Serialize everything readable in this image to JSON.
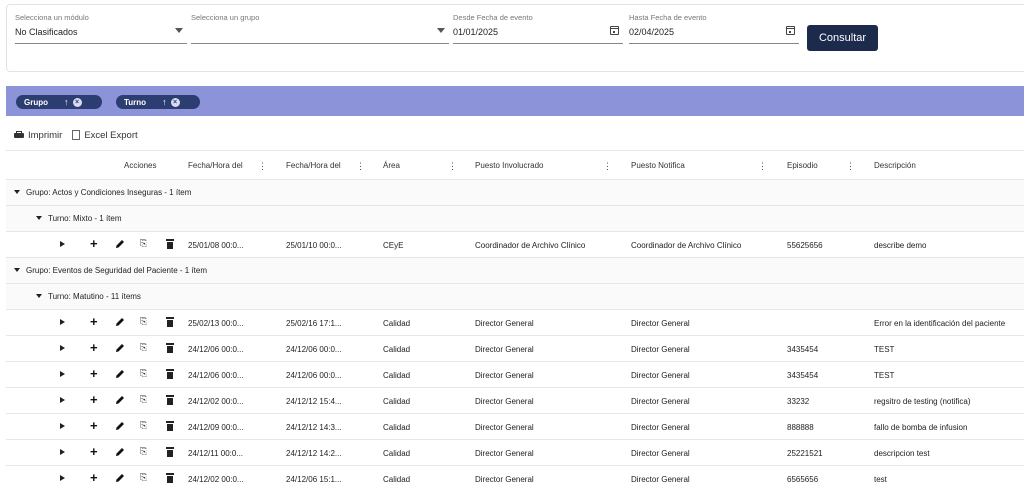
{
  "filters": {
    "modulo": {
      "label": "Selecciona un módulo",
      "value": "No Clasificados"
    },
    "grupo": {
      "label": "Selecciona un grupo",
      "value": ""
    },
    "desde": {
      "label": "Desde Fecha de evento",
      "value": "01/01/2025"
    },
    "hasta": {
      "label": "Hasta Fecha de evento",
      "value": "02/04/2025"
    },
    "consultar_label": "Consultar"
  },
  "group_chips": [
    {
      "label": "Grupo",
      "arrow": "↑",
      "remove": "×"
    },
    {
      "label": "Turno",
      "arrow": "↑",
      "remove": "×"
    }
  ],
  "toolbar": {
    "print_label": "Imprimir",
    "excel_label": "Excel Export"
  },
  "columns": {
    "acciones": "Acciones",
    "fecha_hora_1": "Fecha/Hora del",
    "fecha_hora_2": "Fecha/Hora del",
    "area": "Área",
    "puesto_involucrado": "Puesto Involucrado",
    "puesto_notifica": "Puesto Notifica",
    "episodio": "Episodio",
    "descripcion": "Descripción",
    "menu_glyph": "⋮"
  },
  "groups": [
    {
      "label": "Grupo: Actos y Condiciones Inseguras - 1 ítem"
    },
    {
      "label": "Grupo: Eventos de Seguridad del Paciente - 1 ítem"
    }
  ],
  "subgroups": [
    {
      "label": "Turno: Mixto - 1 ítem"
    },
    {
      "label": "Turno: Matutino - 11 ítems"
    }
  ],
  "icons": {
    "plus": "+",
    "clip": "⎘"
  },
  "rows": [
    {
      "fecha1": "25/01/08 00:0...",
      "fecha2": "25/01/10 00:0...",
      "area": "CEyE",
      "puesto_involucrado": "Coordinador de Archivo Clínico",
      "puesto_notifica": "Coordinador de Archivo Clínico",
      "episodio": "55625656",
      "descripcion": "describe demo"
    },
    {
      "fecha1": "25/02/13 00:0...",
      "fecha2": "25/02/16 17:1...",
      "area": "Calidad",
      "puesto_involucrado": "Director General",
      "puesto_notifica": "Director General",
      "episodio": "",
      "descripcion": "Error en la identificación del paciente"
    },
    {
      "fecha1": "24/12/06 00:0...",
      "fecha2": "24/12/06 00:0...",
      "area": "Calidad",
      "puesto_involucrado": "Director General",
      "puesto_notifica": "Director General",
      "episodio": "3435454",
      "descripcion": "TEST"
    },
    {
      "fecha1": "24/12/06 00:0...",
      "fecha2": "24/12/06 00:0...",
      "area": "Calidad",
      "puesto_involucrado": "Director General",
      "puesto_notifica": "Director General",
      "episodio": "3435454",
      "descripcion": "TEST"
    },
    {
      "fecha1": "24/12/02 00:0...",
      "fecha2": "24/12/12 15:4...",
      "area": "Calidad",
      "puesto_involucrado": "Director General",
      "puesto_notifica": "Director General",
      "episodio": "33232",
      "descripcion": "regsitro de testing (notifica)"
    },
    {
      "fecha1": "24/12/09 00:0...",
      "fecha2": "24/12/12 14:3...",
      "area": "Calidad",
      "puesto_involucrado": "Director General",
      "puesto_notifica": "Director General",
      "episodio": "888888",
      "descripcion": "fallo de bomba de infusion"
    },
    {
      "fecha1": "24/12/11 00:0...",
      "fecha2": "24/12/12 14:2...",
      "area": "Calidad",
      "puesto_involucrado": "Director General",
      "puesto_notifica": "Director General",
      "episodio": "25221521",
      "descripcion": "descripcion test"
    },
    {
      "fecha1": "24/12/02 00:0...",
      "fecha2": "24/12/06 15:1...",
      "area": "Calidad",
      "puesto_involucrado": "Director General",
      "puesto_notifica": "Director General",
      "episodio": "6565656",
      "descripcion": "test"
    }
  ]
}
